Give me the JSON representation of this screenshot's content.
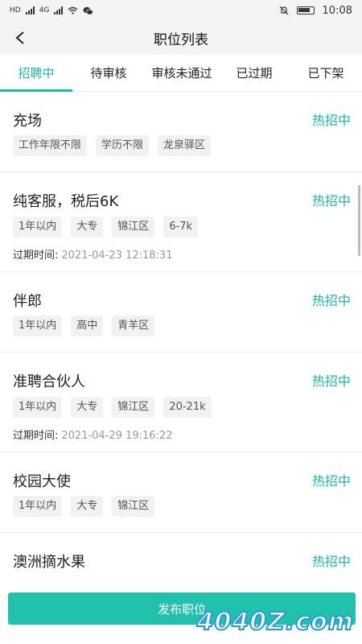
{
  "status_bar": {
    "time": "10:08",
    "net_left": "HD",
    "net_4g": "4G"
  },
  "navbar": {
    "title": "职位列表"
  },
  "tabs": [
    {
      "label": "招聘中",
      "active": true
    },
    {
      "label": "待审核",
      "active": false
    },
    {
      "label": "审核未通过",
      "active": false
    },
    {
      "label": "已过期",
      "active": false
    },
    {
      "label": "已下架",
      "active": false
    }
  ],
  "jobs": [
    {
      "title": "充场",
      "status": "热招中",
      "tags": [
        "工作年限不限",
        "学历不限",
        "龙泉驿区"
      ]
    },
    {
      "title": "纯客服，税后6K",
      "status": "热招中",
      "tags": [
        "1年以内",
        "大专",
        "锦江区",
        "6-7k"
      ],
      "expire_label": "过期时间:",
      "expire_value": "2021-04-23 12:18:31"
    },
    {
      "title": "伴郎",
      "status": "热招中",
      "tags": [
        "1年以内",
        "高中",
        "青羊区"
      ]
    },
    {
      "title": "准聘合伙人",
      "status": "热招中",
      "tags": [
        "1年以内",
        "大专",
        "锦江区",
        "20-21k"
      ],
      "expire_label": "过期时间:",
      "expire_value": "2021-04-29 19:16:22"
    },
    {
      "title": "校园大使",
      "status": "热招中",
      "tags": [
        "1年以内",
        "大专",
        "锦江区"
      ]
    },
    {
      "title": "澳洲摘水果",
      "status": "热招中",
      "tags": []
    }
  ],
  "publish_button": {
    "label": "发布职位"
  },
  "watermark": "4040Z.com",
  "colors": {
    "accent": "#1fb9a5",
    "button": "#21c1ac"
  }
}
